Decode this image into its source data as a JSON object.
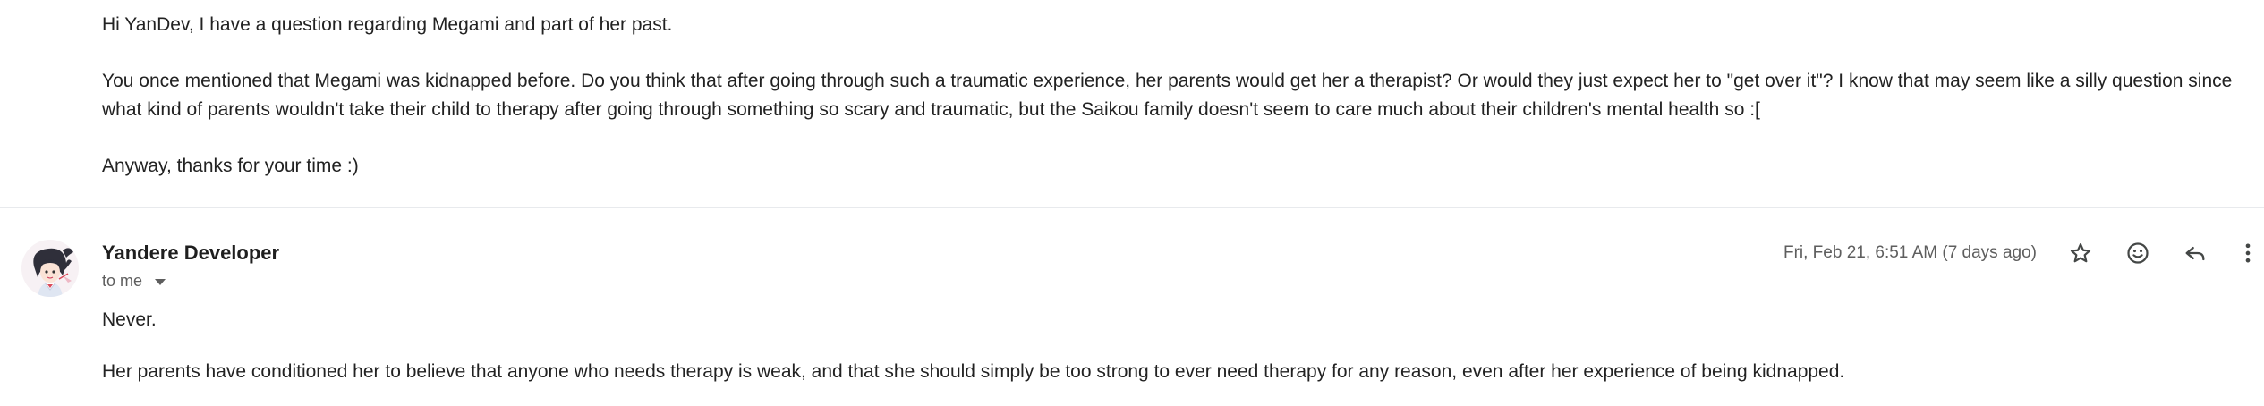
{
  "previous_message": {
    "greeting": "Hi YanDev, I have a question regarding Megami and part of her past.",
    "body_line_1": "You once mentioned that Megami was kidnapped before. Do you think that after going through such a traumatic experience, her parents would get her a therapist? Or would they just expect her to \"get over it\"? I know that may seem like a silly question since",
    "body_line_2": "what kind of parents wouldn't take their child to therapy after going through something so scary and traumatic, but the Saikou family doesn't seem to care much about their children's mental health so :[",
    "closing": "Anyway, thanks for your time :)"
  },
  "reply_message": {
    "sender_name": "Yandere Developer",
    "recipient_label": "to me",
    "timestamp": "Fri, Feb 21, 6:51 AM (7 days ago)",
    "body_line_1": "Never.",
    "body_line_2": "Her parents have conditioned her to believe that anyone who needs therapy is weak, and that she should simply be too strong to ever need therapy for any reason, even after her experience of being kidnapped."
  },
  "icons": {
    "star": "star-icon",
    "emoji": "emoji-icon",
    "reply": "reply-icon",
    "more": "more-vert-icon"
  },
  "colors": {
    "text": "#222222",
    "muted": "#5e5e5e",
    "divider": "#e8eaed",
    "icon": "#444746"
  }
}
